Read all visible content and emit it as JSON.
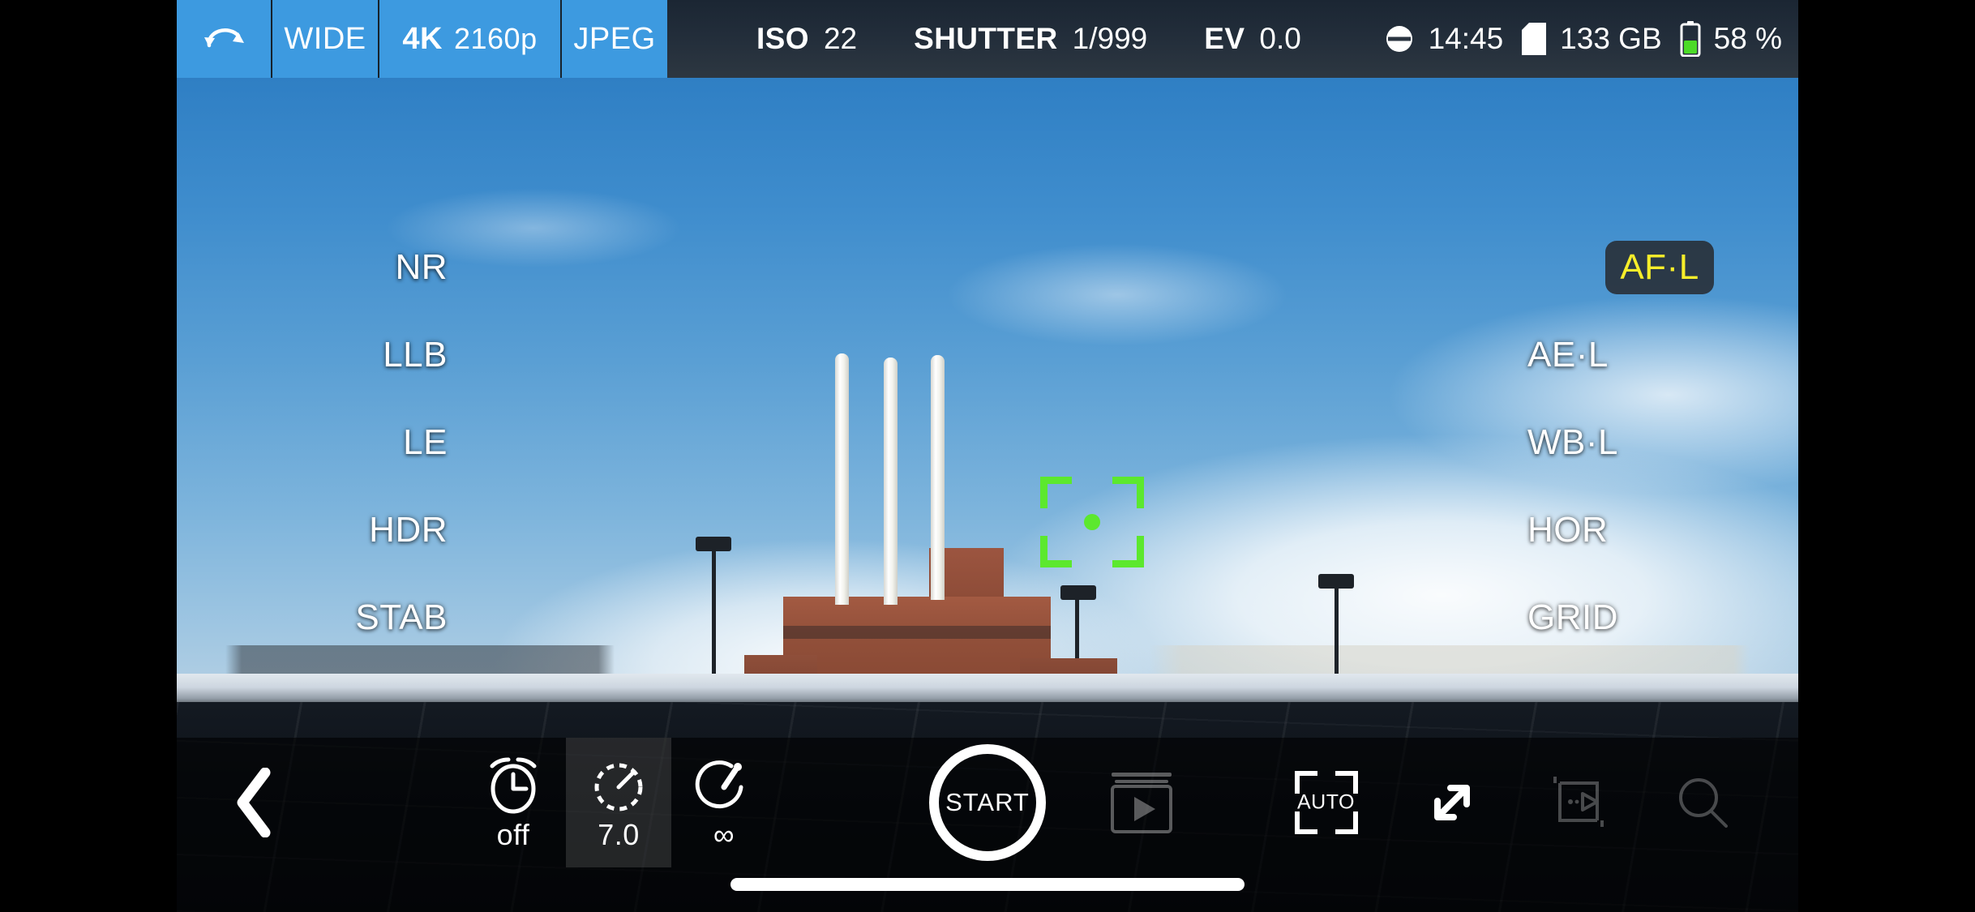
{
  "topbar": {
    "rotate_icon": "rotate-camera-icon",
    "lens": "WIDE",
    "resolution_label": "4K",
    "resolution_value": "2160p",
    "format": "JPEG",
    "exposure": {
      "iso_label": "ISO",
      "iso_value": "22",
      "shutter_label": "SHUTTER",
      "shutter_value": "1/999",
      "ev_label": "EV",
      "ev_value": "0.0"
    },
    "status": {
      "clock_icon": "clock-icon",
      "time": "14:45",
      "sd_icon": "sd-card-icon",
      "storage": "133 GB",
      "battery_icon": "battery-icon",
      "battery": "58 %",
      "battery_level_percent": 58,
      "battery_color": "#4cdb28"
    }
  },
  "viewfinder": {
    "left_labels": [
      {
        "label": "NR",
        "active": false
      },
      {
        "label": "LLB",
        "active": false
      },
      {
        "label": "LE",
        "active": false
      },
      {
        "label": "HDR",
        "active": false
      },
      {
        "label": "STAB",
        "active": false
      }
    ],
    "right_labels": [
      {
        "label": "AF·L",
        "active": true
      },
      {
        "label": "AE·L",
        "active": false
      },
      {
        "label": "WB·L",
        "active": false
      },
      {
        "label": "HOR",
        "active": false
      },
      {
        "label": "GRID",
        "active": false
      }
    ],
    "focus_box": {
      "name": "focus-box",
      "color": "#5ce82e"
    }
  },
  "bottombar": {
    "back_icon": "back-chevron-icon",
    "timer_group": [
      {
        "icon": "alarm-clock-icon",
        "label": "off",
        "highlight": false
      },
      {
        "icon": "interval-timer-icon",
        "label": "7.0",
        "highlight": true
      },
      {
        "icon": "stopwatch-icon",
        "label": "∞",
        "highlight": false
      }
    ],
    "shutter": {
      "label": "START"
    },
    "gallery_icon": "gallery-play-icon",
    "right_group": [
      {
        "icon": "auto-focus-bracket-icon",
        "label": "AUTO",
        "dim": false
      },
      {
        "icon": "resize-diagonal-icon",
        "label": "",
        "dim": false
      },
      {
        "icon": "timelapse-preview-icon",
        "label": "",
        "dim": true
      },
      {
        "icon": "magnifier-icon",
        "label": "",
        "dim": true
      }
    ],
    "home_indicator": "home-indicator"
  },
  "colors": {
    "accent_blue": "#3d9ae0",
    "active_yellow": "#f7ee2a",
    "focus_green": "#5ce82e",
    "bar_dark": "#222d3a"
  }
}
